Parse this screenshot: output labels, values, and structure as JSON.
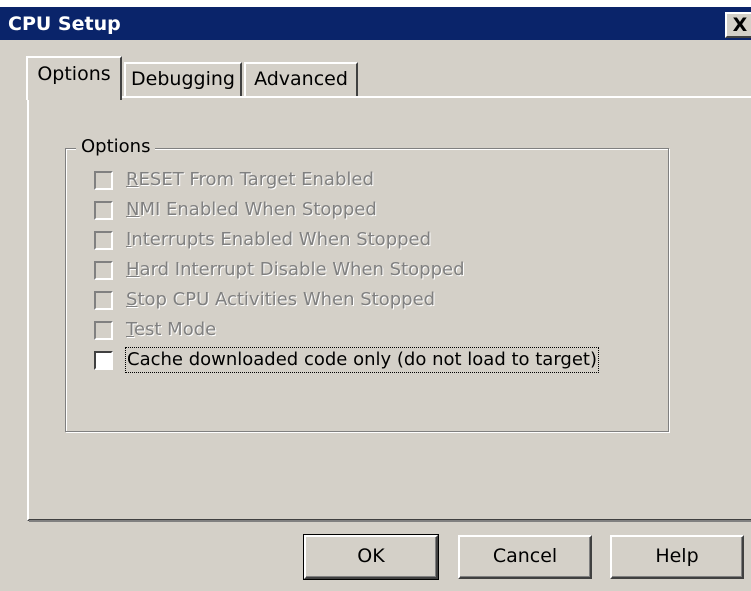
{
  "window": {
    "title": "CPU Setup",
    "close_glyph": "X"
  },
  "tabs": [
    {
      "label": "Options",
      "active": true
    },
    {
      "label": "Debugging",
      "active": false
    },
    {
      "label": "Advanced",
      "active": false
    }
  ],
  "options_group": {
    "label": "Options",
    "items": [
      {
        "mnemonic": "R",
        "rest": "ESET From Target Enabled",
        "enabled": false,
        "checked": false
      },
      {
        "mnemonic": "N",
        "rest": "MI Enabled When Stopped",
        "enabled": false,
        "checked": false
      },
      {
        "mnemonic": "I",
        "rest": "nterrupts Enabled When Stopped",
        "enabled": false,
        "checked": false
      },
      {
        "mnemonic": "H",
        "rest": "ard Interrupt Disable When Stopped",
        "enabled": false,
        "checked": false
      },
      {
        "mnemonic": "S",
        "rest": "top CPU Activities When Stopped",
        "enabled": false,
        "checked": false
      },
      {
        "mnemonic": "T",
        "rest": "est Mode",
        "enabled": false,
        "checked": false
      },
      {
        "mnemonic": "",
        "rest": "Cache downloaded code only (do not load to target)",
        "enabled": true,
        "checked": false
      }
    ]
  },
  "buttons": {
    "ok": "OK",
    "cancel": "Cancel",
    "help": "Help"
  },
  "colors": {
    "titlebar": "#0a246a",
    "face": "#d4d0c8",
    "disabled_text": "#808080"
  }
}
